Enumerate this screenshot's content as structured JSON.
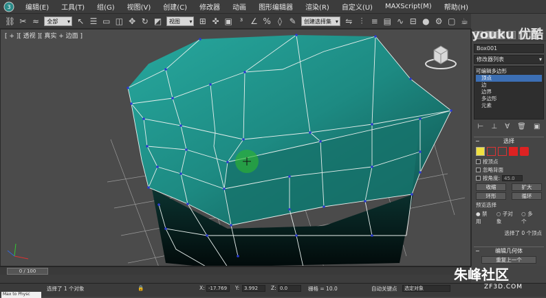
{
  "menubar": {
    "items": [
      "编辑(E)",
      "工具(T)",
      "组(G)",
      "视图(V)",
      "创建(C)",
      "修改器",
      "动画",
      "图形编辑器",
      "渲染(R)",
      "自定义(U)",
      "MAXScript(M)",
      "帮助(H)"
    ]
  },
  "toolbar": {
    "filter_select": "全部",
    "refcoord_select": "视图",
    "named_sel": "创建选择集"
  },
  "viewport": {
    "label": "[ + ][ 透视 ][ 真实 + 边面 ]",
    "mesh_color": "#1e8c84",
    "edge_color": "#e8f0ee",
    "vertex_color": "#2a3ad0",
    "grid_color": "#9a9a9a"
  },
  "command_panel": {
    "object_name": "Box001",
    "modifier_list": "修改器列表",
    "stack": {
      "top": "可编辑多边形",
      "items": [
        "顶点",
        "边",
        "边界",
        "多边形",
        "元素"
      ]
    },
    "selection": {
      "title": "选择",
      "by_vertex": "按顶点",
      "ignore_backfacing": "忽略背面",
      "by_angle": "按角度:",
      "angle_value": "45.0",
      "shrink": "收缩",
      "grow": "扩大",
      "ring": "环形",
      "loop": "循环",
      "preview_title": "预览选择",
      "preview_options": [
        "禁用",
        "子对象",
        "多个"
      ],
      "status": "选择了 0 个顶点"
    },
    "edit_geometry": {
      "title": "编辑几何体",
      "repeat_last": "重复上一个"
    }
  },
  "timeline": {
    "frame": "0 / 100"
  },
  "statusbar": {
    "selected": "选择了 1 个对象",
    "x_label": "X:",
    "x_value": "-17.769",
    "y_label": "Y:",
    "y_value": "3.992",
    "z_label": "Z:",
    "z_value": "0.0",
    "grid": "栅格 = 10.0",
    "autokey": "自动关键点",
    "selected_obj": "选定对象",
    "maxscript": "Max to Physc"
  },
  "watermark": {
    "youku": "youku 优酷",
    "community": "朱峰社区",
    "site": "ZF3D.COM"
  }
}
